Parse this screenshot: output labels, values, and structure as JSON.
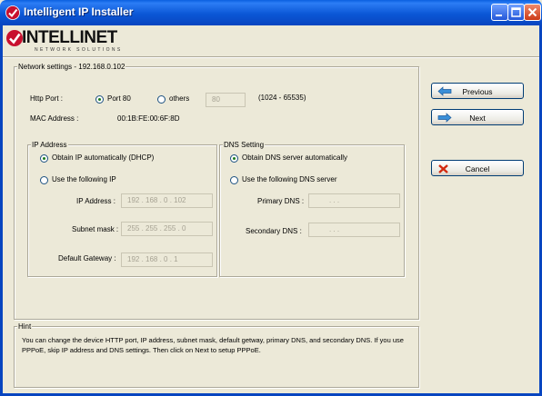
{
  "window": {
    "title": "Intelligent IP Installer"
  },
  "logo": {
    "brand": "INTELLINET",
    "tagline": "NETWORK SOLUTIONS"
  },
  "network": {
    "legend": "Network settings - 192.168.0.102",
    "http_port_label": "Http Port :",
    "port80_label": "Port 80",
    "others_label": "others",
    "others_value": "80",
    "port_range": "(1024 - 65535)",
    "mac_label": "MAC Address :",
    "mac_value": "00:1B:FE:00:6F:8D"
  },
  "ip": {
    "legend": "IP Address",
    "auto_label": "Obtain IP automatically (DHCP)",
    "manual_label": "Use the following IP",
    "ip_label": "IP Address :",
    "ip_value": "192 . 168 . 0 . 102",
    "mask_label": "Subnet mask :",
    "mask_value": "255 . 255 . 255 . 0",
    "gateway_label": "Default Gateway :",
    "gateway_value": "192 . 168 . 0 . 1"
  },
  "dns": {
    "legend": "DNS Setting",
    "auto_label": "Obtain DNS server automatically",
    "manual_label": "Use the following DNS server",
    "primary_label": "Primary DNS :",
    "primary_value": ".   .   .",
    "secondary_label": "Secondary DNS :",
    "secondary_value": ".   .   ."
  },
  "buttons": {
    "previous": "Previous",
    "next": "Next",
    "cancel": "Cancel"
  },
  "hint": {
    "legend": "Hint",
    "text": "You can change the device HTTP port, IP address, subnet mask, default getway, primary DNS, and secondary DNS. If you use PPPoE, skip IP address and DNS settings. Then click on Next to setup PPPoE."
  },
  "colors": {
    "titlebar": "#0b57d6",
    "window_bg": "#ece9d8",
    "accent_green": "#1c7a1c"
  },
  "icons": [
    "app-logo-icon",
    "minimize-icon",
    "maximize-icon",
    "close-icon",
    "arrow-left-icon",
    "arrow-right-icon",
    "cancel-x-icon"
  ]
}
